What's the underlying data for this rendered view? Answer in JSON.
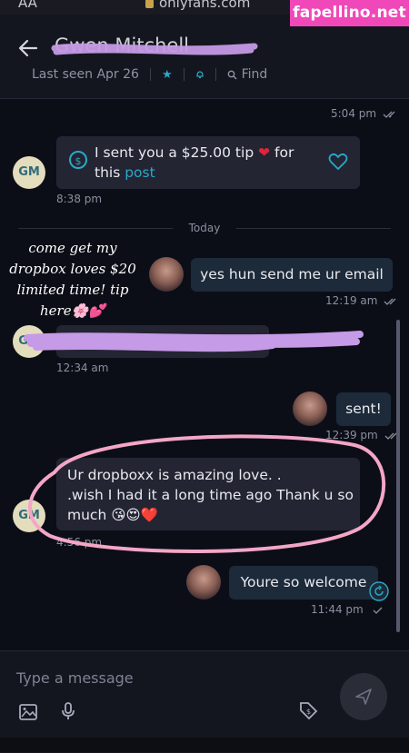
{
  "browser": {
    "text_size_label": "AA",
    "url": "onlyfans.com"
  },
  "watermark": "fapellino.net",
  "header": {
    "contact_name": "Gwen Mitchell",
    "last_seen": "Last seen Apr 26",
    "find_label": "Find"
  },
  "messages": {
    "m1": {
      "time": "5:04 pm"
    },
    "m2": {
      "initials": "GM",
      "text_a": "I sent you a $25.00 tip ",
      "text_b": " for",
      "text_c": "this ",
      "link": "post",
      "time": "8:38 pm"
    },
    "divider": "Today",
    "m3": {
      "text": "yes hun send me ur email",
      "time": "12:19 am"
    },
    "m4": {
      "initials": "GM",
      "text": "••••••••••@yahoo.com",
      "time": "12:34 am"
    },
    "m5": {
      "text": "sent!",
      "time": "12:39 pm"
    },
    "m6": {
      "initials": "GM",
      "line1": "Ur dropboxx is amazing love. .",
      "line2": ".wish I had it a long time ago Thank u so",
      "line3": "much 😘😍❤️",
      "time": "4:56 pm"
    },
    "m7": {
      "text": "Youre so welcome",
      "time": "11:44 pm"
    }
  },
  "overlay": {
    "line1": "come get my",
    "line2": "dropbox loves $20",
    "line3": "limited time! tip",
    "line4": "here🌸💕"
  },
  "composer": {
    "placeholder": "Type a message"
  },
  "colors": {
    "accent": "#2aa8c7",
    "scribble": "#c59ae6",
    "circle": "#f4a6c6",
    "watermark": "#f048b8"
  }
}
